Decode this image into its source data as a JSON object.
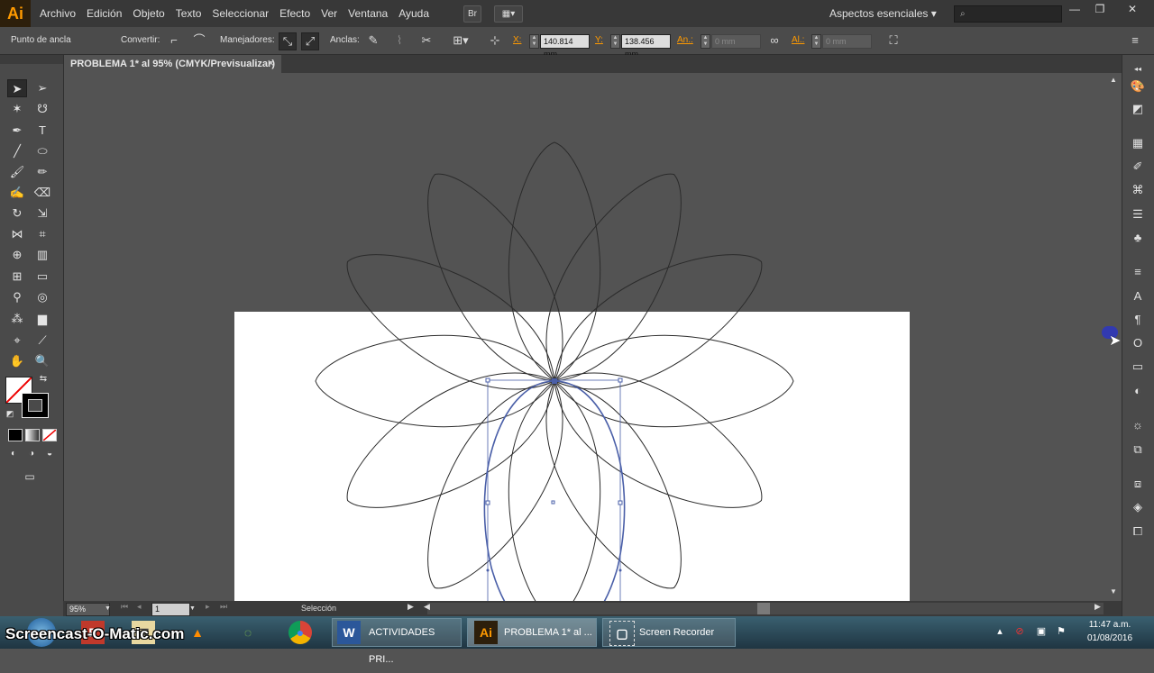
{
  "app": {
    "logo": "Ai"
  },
  "menu": [
    "Archivo",
    "Edición",
    "Objeto",
    "Texto",
    "Seleccionar",
    "Efecto",
    "Ver",
    "Ventana",
    "Ayuda"
  ],
  "menubar": {
    "bridge_label": "Br",
    "workspace": "Aspectos esenciales ▾",
    "search_placeholder": "",
    "min": "—",
    "max": "❐",
    "close": "✕"
  },
  "control": {
    "context_label": "Punto de ancla",
    "convert_label": "Convertir:",
    "handles_label": "Manejadores:",
    "anchors_label": "Anclas:",
    "x_label": "X:",
    "x_value": "140.814 mm",
    "y_label": "Y:",
    "y_value": "138.456 mm",
    "w_label": "An.:",
    "w_value": "0 mm",
    "h_label": "Al.:",
    "h_value": "0 mm"
  },
  "document": {
    "tab_title": "PROBLEMA 1* al 95% (CMYK/Previsualizar)",
    "tab_close": "✕"
  },
  "status": {
    "zoom": "95%",
    "page": "1",
    "tool": "Selección"
  },
  "taskbar": {
    "watermark": "Screencast-O-Matic.com",
    "word_label": "ACTIVIDADES PRI...",
    "ai_label": "PROBLEMA 1* al ...",
    "recorder_label": "Screen Recorder",
    "time": "11:47 a.m.",
    "date": "01/08/2016"
  },
  "colors": {
    "accent": "#ff9a00",
    "selection": "#4a5fa8",
    "artboard": "#ffffff",
    "canvas": "#535353"
  }
}
